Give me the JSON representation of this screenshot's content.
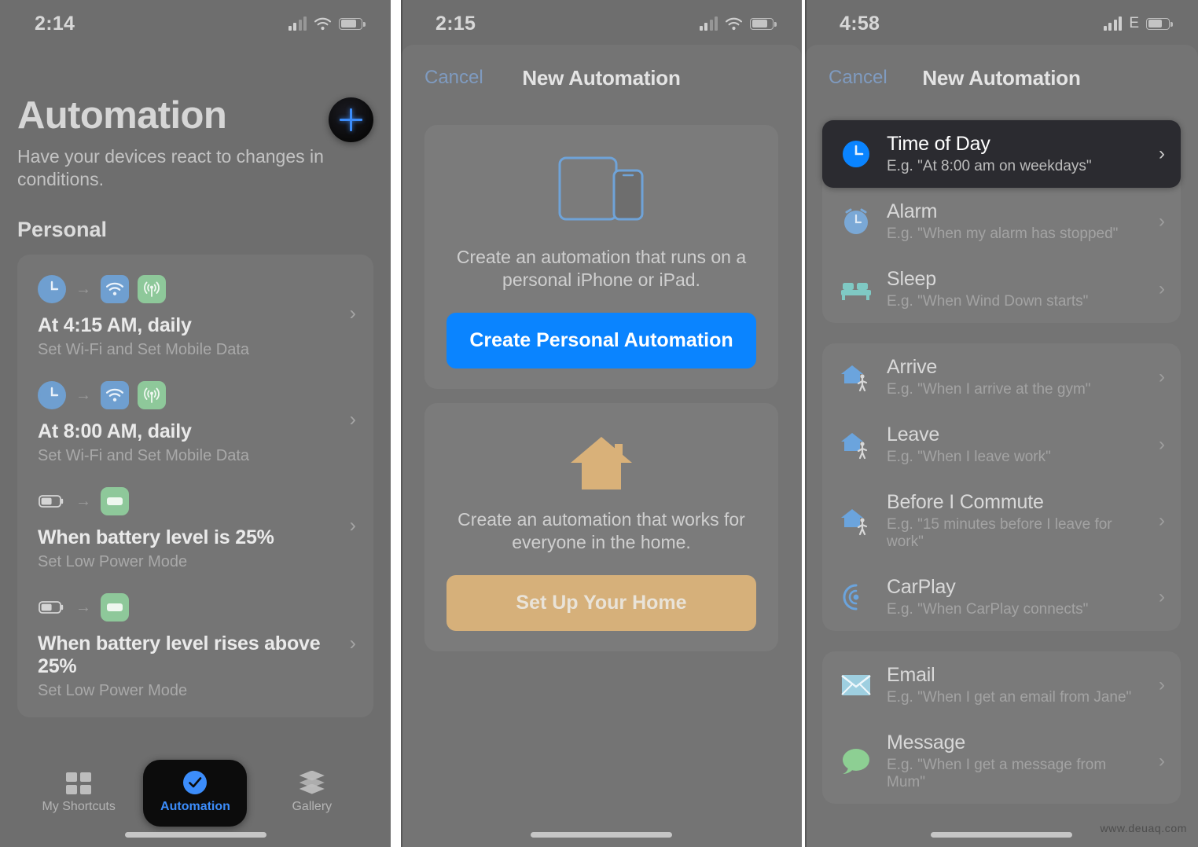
{
  "watermark": "www.deuaq.com",
  "panel1": {
    "status": {
      "time": "2:14",
      "signal_bars": 2,
      "wifi": true,
      "battery_pct": 72
    },
    "add_button": "add-automation",
    "title": "Automation",
    "subtitle": "Have your devices react to changes in conditions.",
    "section_header": "Personal",
    "automations": [
      {
        "title": "At 4:15 AM, daily",
        "subtitle": "Set Wi-Fi and Set Mobile Data",
        "trigger_icon": "clock-icon",
        "action_icons": [
          "wifi-icon",
          "cellular-icon"
        ]
      },
      {
        "title": "At 8:00 AM, daily",
        "subtitle": "Set Wi-Fi and Set Mobile Data",
        "trigger_icon": "clock-icon",
        "action_icons": [
          "wifi-icon",
          "cellular-icon"
        ]
      },
      {
        "title": "When battery level is 25%",
        "subtitle": "Set Low Power Mode",
        "trigger_icon": "battery-icon",
        "action_icons": [
          "battery-green-icon"
        ]
      },
      {
        "title": "When battery level rises above 25%",
        "subtitle": "Set Low Power Mode",
        "trigger_icon": "battery-icon",
        "action_icons": [
          "battery-green-icon"
        ]
      }
    ],
    "tabs": [
      {
        "label": "My Shortcuts",
        "icon": "grid-icon",
        "active": false
      },
      {
        "label": "Automation",
        "icon": "clock-check-icon",
        "active": true
      },
      {
        "label": "Gallery",
        "icon": "layers-icon",
        "active": false
      }
    ]
  },
  "panel2": {
    "status": {
      "time": "2:15",
      "signal_bars": 2,
      "wifi": true,
      "battery_pct": 72
    },
    "nav": {
      "cancel": "Cancel",
      "title": "New Automation"
    },
    "cards": [
      {
        "icon": "devices-icon",
        "text": "Create an automation that runs on a personal iPhone or iPad.",
        "button": "Create Personal Automation",
        "button_style": "blue"
      },
      {
        "icon": "house-icon",
        "text": "Create an automation that works for everyone in the home.",
        "button": "Set Up Your Home",
        "button_style": "tan"
      }
    ]
  },
  "panel3": {
    "status": {
      "time": "4:58",
      "signal_bars": 4,
      "network": "E",
      "battery_pct": 62
    },
    "nav": {
      "cancel": "Cancel",
      "title": "New Automation"
    },
    "groups": [
      {
        "items": [
          {
            "title": "Time of Day",
            "eg": "E.g. \"At 8:00 am on weekdays\"",
            "icon": "clock-icon",
            "selected": true
          },
          {
            "title": "Alarm",
            "eg": "E.g. \"When my alarm has stopped\"",
            "icon": "alarm-clock-icon",
            "selected": false
          },
          {
            "title": "Sleep",
            "eg": "E.g. \"When Wind Down starts\"",
            "icon": "bed-icon",
            "selected": false
          }
        ]
      },
      {
        "items": [
          {
            "title": "Arrive",
            "eg": "E.g. \"When I arrive at the gym\"",
            "icon": "house-walk-icon",
            "selected": false
          },
          {
            "title": "Leave",
            "eg": "E.g. \"When I leave work\"",
            "icon": "house-walk-icon",
            "selected": false
          },
          {
            "title": "Before I Commute",
            "eg": "E.g. \"15 minutes before I leave for work\"",
            "icon": "house-walk-icon",
            "selected": false
          },
          {
            "title": "CarPlay",
            "eg": "E.g. \"When CarPlay connects\"",
            "icon": "carplay-icon",
            "selected": false
          }
        ]
      },
      {
        "items": [
          {
            "title": "Email",
            "eg": "E.g. \"When I get an email from Jane\"",
            "icon": "envelope-icon",
            "selected": false
          },
          {
            "title": "Message",
            "eg": "E.g. \"When I get a message from Mum\"",
            "icon": "message-bubble-icon",
            "selected": false
          }
        ]
      }
    ]
  },
  "colors": {
    "accent_blue": "#0a84ff",
    "tan": "#d6b07a",
    "green": "#8ec89a",
    "screen_bg": "#6e6e6e",
    "selected_row": "#2b2b30"
  }
}
